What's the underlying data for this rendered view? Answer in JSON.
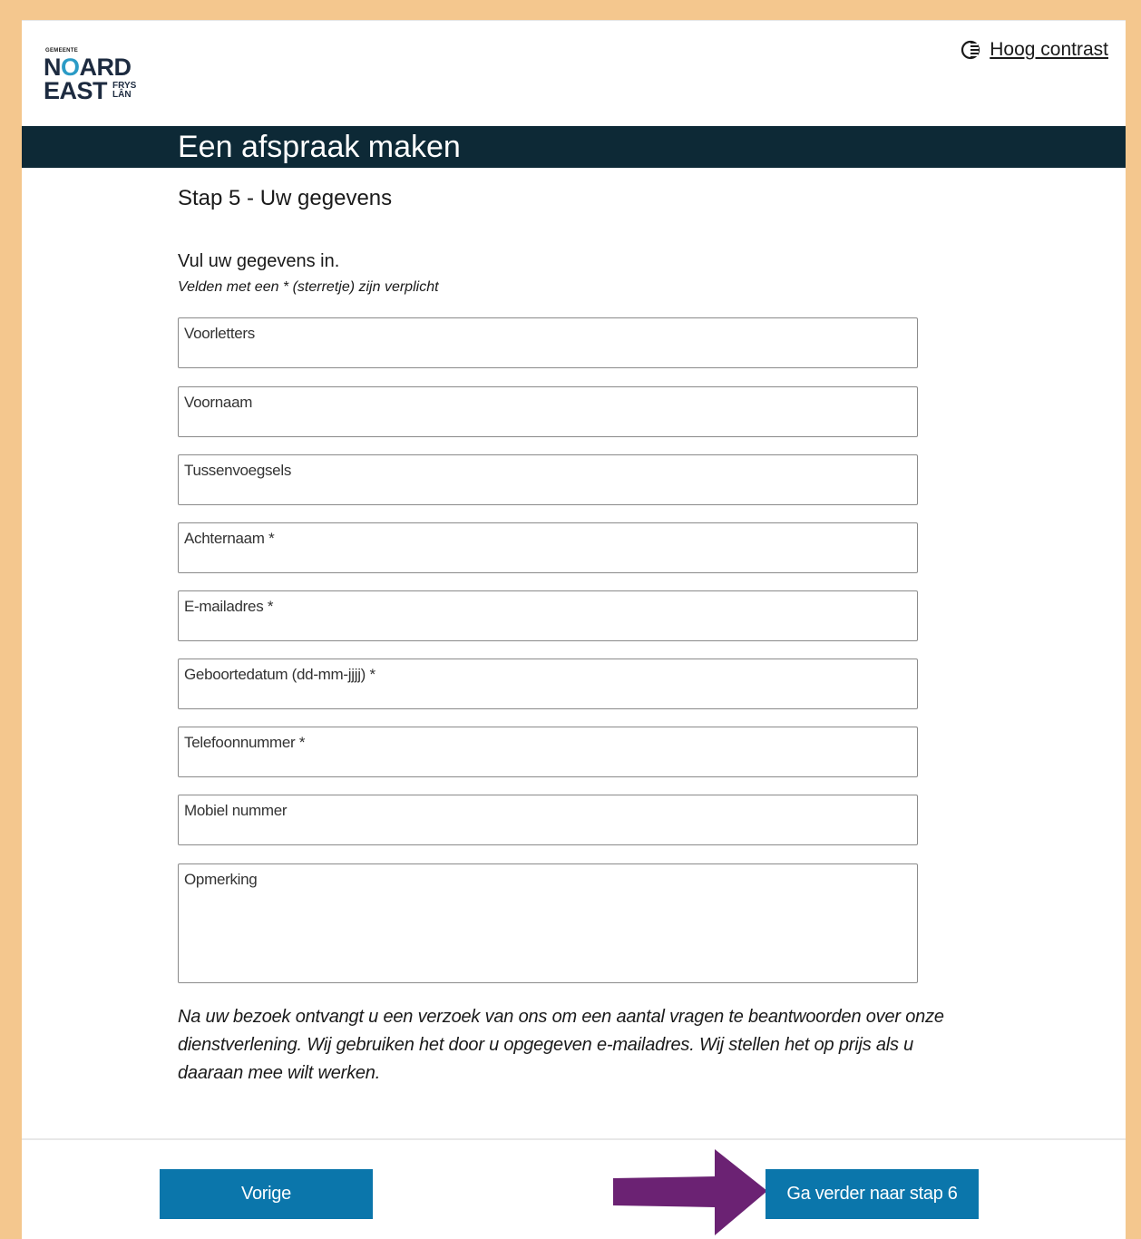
{
  "brand": {
    "small": "GEMEENTE",
    "line1_a": "N",
    "line1_b": "O",
    "line1_c": "ARD",
    "line2": "EAST",
    "frys": "FRYS",
    "lan": "LÂN"
  },
  "header": {
    "contrast_label": "Hoog contrast",
    "contrast_icon": "contrast-icon"
  },
  "banner": {
    "title": "Een afspraak maken"
  },
  "step": {
    "title": "Stap 5 - Uw gegevens"
  },
  "form": {
    "intro": "Vul uw gegevens in.",
    "required_note": "Velden met een * (sterretje) zijn verplicht",
    "fields": [
      {
        "label": "Voorletters",
        "value": ""
      },
      {
        "label": "Voornaam",
        "value": ""
      },
      {
        "label": "Tussenvoegsels",
        "value": ""
      },
      {
        "label": "Achternaam *",
        "value": ""
      },
      {
        "label": "E-mailadres *",
        "value": ""
      },
      {
        "label": "Geboortedatum (dd-mm-jjjj) *",
        "value": ""
      },
      {
        "label": "Telefoonnummer *",
        "value": ""
      },
      {
        "label": "Mobiel nummer",
        "value": ""
      },
      {
        "label": "Opmerking",
        "value": ""
      }
    ],
    "notice": "Na uw bezoek ontvangt u een verzoek van ons om een aantal vragen te beantwoorden over onze dienstverlening. Wij gebruiken het door u opgegeven e-mailadres. Wij stellen het op prijs als u daaraan mee wilt werken."
  },
  "footer": {
    "prev_label": "Vorige",
    "next_label": "Ga verder naar stap 6"
  },
  "colors": {
    "frame_border": "#f4c78e",
    "banner": "#0d2936",
    "button": "#0b76ab",
    "arrow": "#6b2273",
    "logo_accent": "#2b9bc6"
  }
}
